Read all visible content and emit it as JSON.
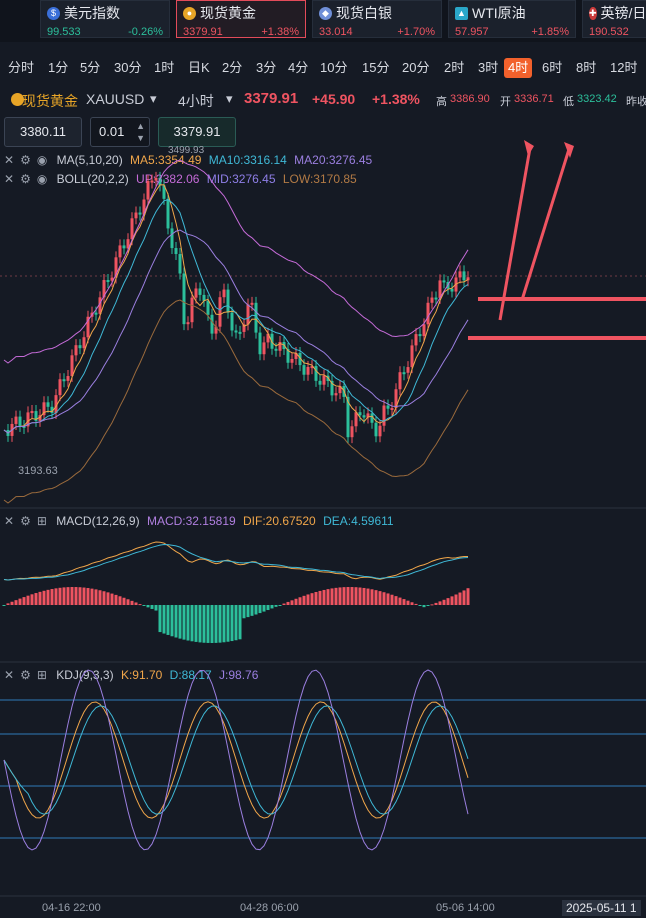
{
  "tickers": [
    {
      "name": "美元指数",
      "price": "99.533",
      "change": "-0.26%",
      "dir": "down",
      "icon": "us-flag-icon",
      "icon_char": "$",
      "icon_color": "#3a6fd8",
      "selected": false
    },
    {
      "name": "现货黄金",
      "price": "3379.91",
      "change": "+1.38%",
      "dir": "up",
      "icon": "gold-coin-icon",
      "icon_char": "●",
      "icon_color": "#e8a527",
      "selected": true
    },
    {
      "name": "现货白银",
      "price": "33.014",
      "change": "+1.70%",
      "dir": "up",
      "icon": "silver-coin-icon",
      "icon_char": "◆",
      "icon_color": "#6f8fd8",
      "selected": false
    },
    {
      "name": "WTI原油",
      "price": "57.957",
      "change": "+1.85%",
      "dir": "up",
      "icon": "oil-icon",
      "icon_char": "▲",
      "icon_color": "#2aa7c9",
      "selected": false
    },
    {
      "name": "英镑/日",
      "price": "190.532",
      "change": "",
      "dir": "up",
      "icon": "uk-flag-icon",
      "icon_char": "✚",
      "icon_color": "#c93a3a",
      "selected": false
    }
  ],
  "periods": [
    "分时",
    "1分",
    "5分",
    "30分",
    "1时",
    "日K",
    "2分",
    "3分",
    "4分",
    "10分",
    "15分",
    "20分",
    "2时",
    "3时",
    "4时",
    "6时",
    "8时",
    "12时"
  ],
  "active_period": "4时",
  "symbol": {
    "name": "现货黄金",
    "code": "XAUUSD",
    "interval": "4小时",
    "price": "3379.91",
    "change": "+45.90",
    "change_pct": "+1.38%",
    "high_label": "高",
    "high": "3386.90",
    "open_label": "开",
    "open": "3336.71",
    "low_label": "低",
    "low": "3323.42",
    "close_label": "昨收"
  },
  "controls": {
    "sell_price": "3380.11",
    "quantity": "0.01",
    "buy_price": "3379.91"
  },
  "main_chart": {
    "ma_label": "MA(5,10,20)",
    "ma5": "MA5:3354.49",
    "ma10": "MA10:3316.14",
    "ma20": "MA20:3276.45",
    "boll_label": "BOLL(20,2,2)",
    "up": "UP:3382.06",
    "mid": "MID:3276.45",
    "low": "LOW:3170.85",
    "high_mark": "3499.93",
    "low_mark": "3193.63"
  },
  "macd": {
    "label": "MACD(12,26,9)",
    "macd": "MACD:32.15819",
    "dif": "DIF:20.67520",
    "dea": "DEA:4.59611"
  },
  "kdj": {
    "label": "KDJ(9,3,3)",
    "k": "K:91.70",
    "d": "D:88.17",
    "j": "J:98.76"
  },
  "time_axis": [
    "04-16 22:00",
    "04-28 06:00",
    "05-06 14:00"
  ],
  "current_time": "2025-05-11 1",
  "colors": {
    "up": "#ef5461",
    "down": "#2cbf9b",
    "accent": "#f2612c",
    "ma5": "#f0a64a",
    "ma10": "#3fb8d6",
    "ma20": "#9b7fe0",
    "boll_up": "#c56bd8",
    "boll_low": "#9a6a3c"
  }
}
